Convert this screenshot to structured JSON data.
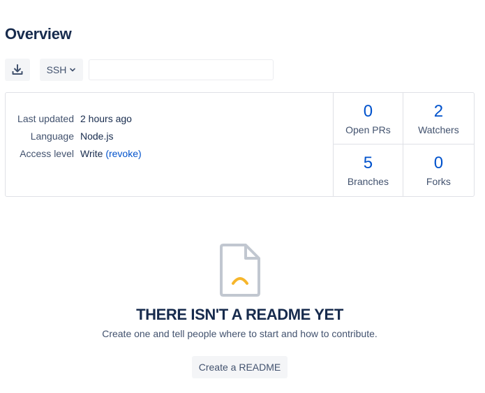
{
  "overview": {
    "title": "Overview"
  },
  "toolbar": {
    "download_icon": "download-icon",
    "protocol": "SSH",
    "protocol_icon": "chevron-down-icon",
    "clone_url": ""
  },
  "repo_info": {
    "rows": [
      {
        "label": "Last updated",
        "value": "2 hours ago"
      },
      {
        "label": "Language",
        "value": "Node.js"
      },
      {
        "label": "Access level",
        "value": "Write",
        "link": "(revoke)"
      }
    ]
  },
  "stats": [
    {
      "count": "0",
      "label": "Open PRs"
    },
    {
      "count": "2",
      "label": "Watchers"
    },
    {
      "count": "5",
      "label": "Branches"
    },
    {
      "count": "0",
      "label": "Forks"
    }
  ],
  "readme": {
    "icon": "sad-document-icon",
    "title": "THERE ISN'T A README YET",
    "subtitle": "Create one and tell people where to start and how to contribute.",
    "button": "Create a README"
  },
  "colors": {
    "accent": "#0052cc",
    "text": "#172b4d",
    "subtle_text": "#42526e",
    "border": "#dfe1e6",
    "button_bg": "#f4f5f7",
    "icon_frown": "#f6b62c"
  }
}
